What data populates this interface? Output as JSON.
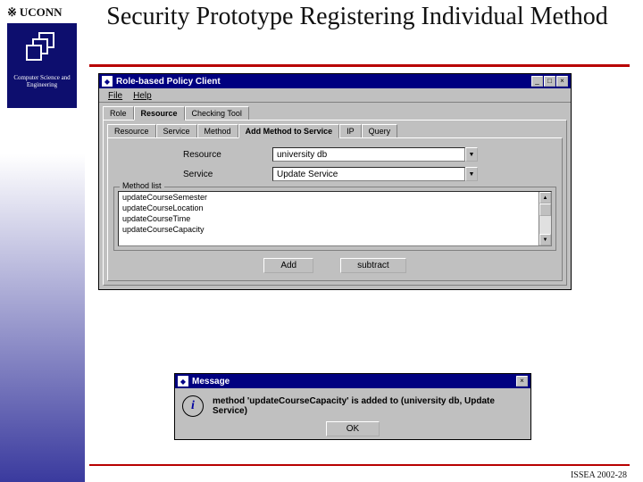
{
  "brand": {
    "name": "UCONN",
    "dept": "Computer Science and Engineering"
  },
  "slide": {
    "title": "Security Prototype Registering Individual Method",
    "footer": "ISSEA 2002-28"
  },
  "app": {
    "title": "Role-based Policy Client",
    "menus": {
      "file": "File",
      "help": "Help"
    },
    "primary_tabs": {
      "role": "Role",
      "resource": "Resource",
      "checking": "Checking Tool"
    },
    "secondary_tabs": {
      "resource": "Resource",
      "service": "Service",
      "method": "Method",
      "add_method": "Add Method to Service",
      "ip": "IP",
      "query": "Query"
    },
    "fields": {
      "resource_label": "Resource",
      "resource_value": "university db",
      "service_label": "Service",
      "service_value": "Update Service"
    },
    "method_list": {
      "legend": "Method list",
      "items": [
        "updateCourseSemester",
        "updateCourseLocation",
        "updateCourseTime",
        "updateCourseCapacity"
      ]
    },
    "buttons": {
      "add": "Add",
      "subtract": "subtract"
    }
  },
  "message": {
    "title": "Message",
    "text": "method 'updateCourseCapacity' is added to (university db, Update Service)",
    "ok": "OK"
  }
}
